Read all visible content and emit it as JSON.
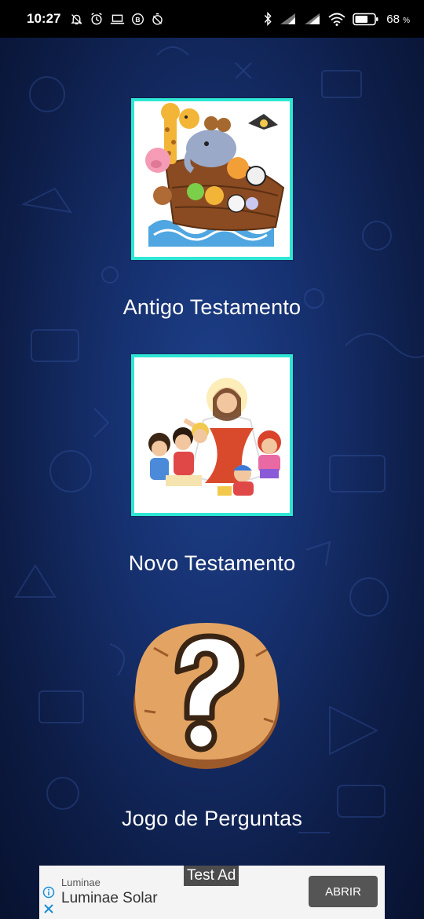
{
  "status_bar": {
    "time": "10:27",
    "battery_percent": "68",
    "battery_unit": "%",
    "battery_level": 0.68,
    "icons_left": [
      "bell-off-icon",
      "alarm-icon",
      "laptop-icon",
      "b-badge-icon",
      "timer-off-icon"
    ],
    "icons_right": [
      "bluetooth-icon",
      "signal-icon",
      "signal-icon",
      "wifi-icon",
      "battery-icon"
    ]
  },
  "menu": {
    "old_testament": {
      "label": "Antigo Testamento",
      "image": "noah-ark-illustration"
    },
    "new_testament": {
      "label": "Novo Testamento",
      "image": "jesus-with-children-illustration"
    },
    "quiz": {
      "label": "Jogo de Perguntas",
      "image": "question-mark-badge"
    }
  },
  "ad": {
    "test_tag": "Test Ad",
    "advertiser": "Luminae",
    "headline": "Luminae Solar",
    "cta": "ABRIR"
  },
  "colors": {
    "background": "#16306e",
    "card_border": "#2ee6d4",
    "quiz_badge": "#e3a463"
  }
}
